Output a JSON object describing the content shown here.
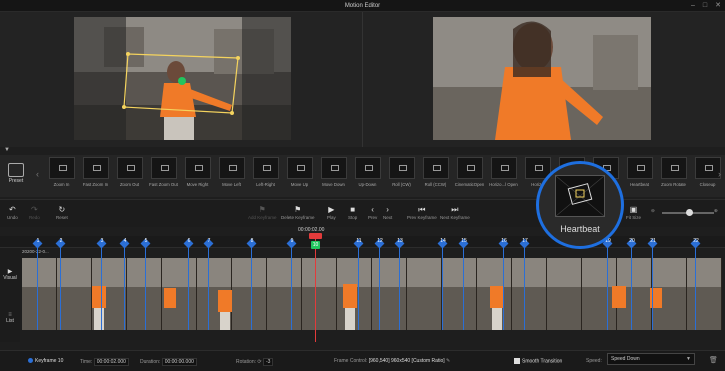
{
  "window": {
    "title": "Motion Editor",
    "controls": [
      "–",
      "□",
      "✕"
    ]
  },
  "preset_panel": {
    "label": "Preset",
    "items": [
      "Zoom In",
      "Fast Zoom In",
      "Zoom Out",
      "Fast Zoom Out",
      "Move Right",
      "Move Left",
      "Left-Right",
      "Move Up",
      "Move Down",
      "Up-Down",
      "Roll (CW)",
      "Roll (CCW)",
      "CinematicOpen",
      "Horizo...l Open",
      "Horizo",
      "Ch",
      "",
      "",
      "Heartbeat",
      "Zoom Rotate",
      "Closeup"
    ],
    "selected": "Heartbeat"
  },
  "toolbar": {
    "undo": "Undo",
    "redo": "Redo",
    "reset": "Reset",
    "add_keyframe": "Add Keyframe",
    "delete_keyframe": "Delete Keyframe",
    "play": "Play",
    "stop": "Stop",
    "prev": "Prev",
    "next": "Next",
    "prev_keyframe": "Prev Keyframe",
    "next_keyframe": "Next Keyframe",
    "fit_size": "Fit Size"
  },
  "timeline": {
    "current_time": "00:00:02.00",
    "track_label": "20200-22-0...",
    "keyframe_numbers": [
      "1",
      "2",
      "3",
      "4",
      "5",
      "6",
      "7",
      "8",
      "9",
      "10",
      "11",
      "12",
      "13",
      "14",
      "15",
      "16",
      "17",
      "18",
      "19",
      "20",
      "21",
      "22"
    ],
    "playhead_number": "10"
  },
  "side_tabs": {
    "visual": "Visual",
    "list": "List"
  },
  "bottom_bar": {
    "keyframe_label": "Keyframe 10",
    "time_label": "Time:",
    "time_value": "00:00:02.000",
    "duration_label": "Duration:",
    "duration_value": "00:00:00.000",
    "rotation_label": "Rotation:",
    "rotation_value": "-3",
    "frame_control_label": "Frame Control:",
    "frame_control_value": "[960,540]  960x540  [Custom Ratio]",
    "smooth_transition": "Smooth Transition",
    "speed_label": "Speed:",
    "speed_value": "Speed Down"
  },
  "colors": {
    "accent": "#1e6fe0",
    "keyframe": "#2b6fd6",
    "playhead": "#e23b3b",
    "current_keyframe": "#22c55e",
    "selection_box": "#f4d35e"
  }
}
